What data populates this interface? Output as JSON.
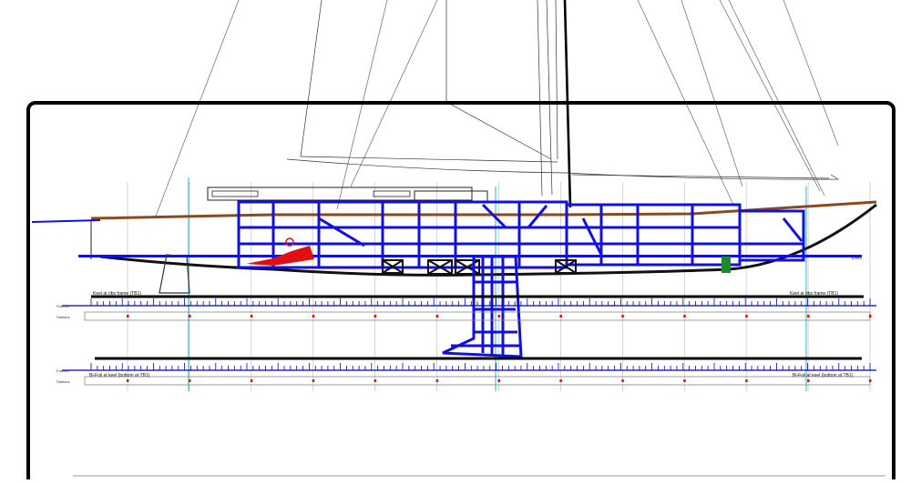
{
  "labels": {
    "top_left": "Keel at ribs frame (TB1)",
    "top_right": "Keel at ribs frame (TB1)",
    "bottom_left": "Bi-Foil at keel (bottom at TB1)",
    "bottom_right": "Bi-Foil at keel (bottom at TB1)",
    "side_top": "Frames",
    "side_bottom": "Stations",
    "dwl": "DWL"
  },
  "colors": {
    "structure": "#1010e0",
    "frame_line": "#0000c8",
    "deck": "#8b4a1e",
    "engine": "#e01010",
    "green_part": "#1a8a2a",
    "cyan_line": "#22b8c8",
    "ink": "#000000"
  },
  "scale": {
    "tick_count": 126,
    "station_count": 13
  }
}
